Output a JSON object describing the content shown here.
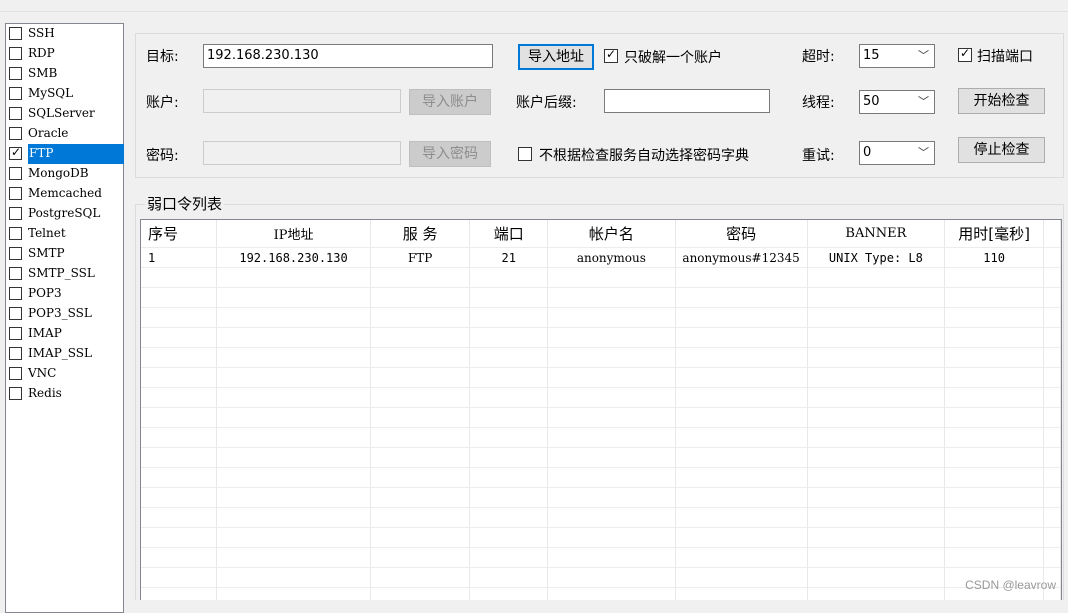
{
  "services": [
    {
      "label": "SSH",
      "checked": false,
      "selected": false
    },
    {
      "label": "RDP",
      "checked": false,
      "selected": false
    },
    {
      "label": "SMB",
      "checked": false,
      "selected": false
    },
    {
      "label": "MySQL",
      "checked": false,
      "selected": false
    },
    {
      "label": "SQLServer",
      "checked": false,
      "selected": false
    },
    {
      "label": "Oracle",
      "checked": false,
      "selected": false
    },
    {
      "label": "FTP",
      "checked": true,
      "selected": true
    },
    {
      "label": "MongoDB",
      "checked": false,
      "selected": false
    },
    {
      "label": "Memcached",
      "checked": false,
      "selected": false
    },
    {
      "label": "PostgreSQL",
      "checked": false,
      "selected": false
    },
    {
      "label": "Telnet",
      "checked": false,
      "selected": false
    },
    {
      "label": "SMTP",
      "checked": false,
      "selected": false
    },
    {
      "label": "SMTP_SSL",
      "checked": false,
      "selected": false
    },
    {
      "label": "POP3",
      "checked": false,
      "selected": false
    },
    {
      "label": "POP3_SSL",
      "checked": false,
      "selected": false
    },
    {
      "label": "IMAP",
      "checked": false,
      "selected": false
    },
    {
      "label": "IMAP_SSL",
      "checked": false,
      "selected": false
    },
    {
      "label": "VNC",
      "checked": false,
      "selected": false
    },
    {
      "label": "Redis",
      "checked": false,
      "selected": false
    }
  ],
  "settings": {
    "target_label": "目标:",
    "target_value": "192.168.230.130",
    "import_address": "导入地址",
    "crack_one_label": "只破解一个账户",
    "crack_one_checked": true,
    "timeout_label": "超时:",
    "timeout_value": "15",
    "scan_port_label": "扫描端口",
    "scan_port_checked": true,
    "account_label": "账户:",
    "account_value": "",
    "import_account": "导入账户",
    "suffix_label": "账户后缀:",
    "suffix_value": "",
    "threads_label": "线程:",
    "threads_value": "50",
    "start_check": "开始检查",
    "password_label": "密码:",
    "password_value": "",
    "import_password": "导入密码",
    "auto_dict_label": "不根据检查服务自动选择密码字典",
    "auto_dict_checked": false,
    "retry_label": "重试:",
    "retry_value": "0",
    "stop_check": "停止检查"
  },
  "result": {
    "title": "弱口令列表",
    "columns": [
      "序号",
      "IP地址",
      "服 务",
      "端口",
      "帐户名",
      "密码",
      "BANNER",
      "用时[毫秒]"
    ],
    "rows": [
      [
        "1",
        "192.168.230.130",
        "FTP",
        "21",
        "anonymous",
        "anonymous#12345",
        "UNIX Type: L8",
        "110"
      ]
    ]
  },
  "watermark": "CSDN @leavrow"
}
